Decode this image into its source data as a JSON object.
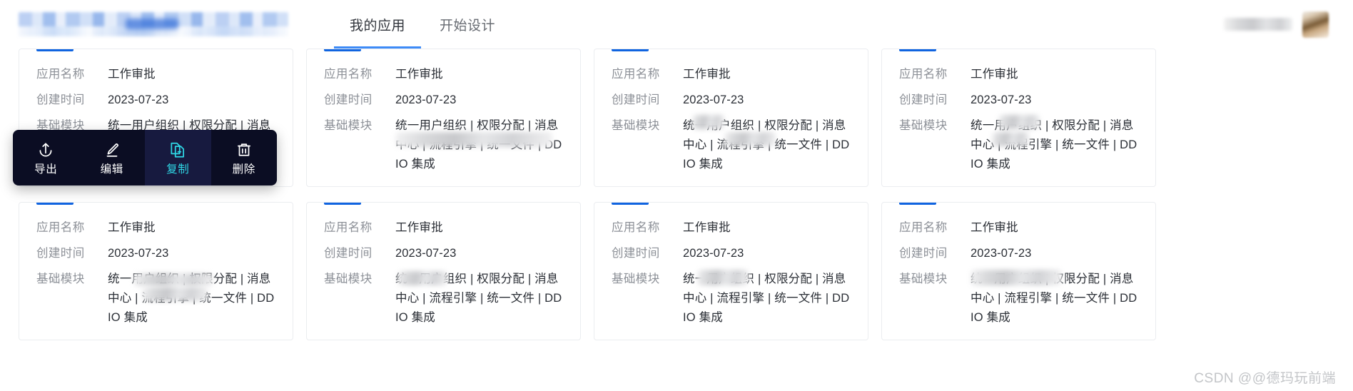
{
  "header": {
    "tabs": [
      {
        "label": "我的应用",
        "active": true
      },
      {
        "label": "开始设计",
        "active": false
      }
    ],
    "logo_alt": "blurred-product-logo",
    "user_alt": "blurred-user-name",
    "avatar_alt": "user-avatar"
  },
  "card_labels": {
    "name": "应用名称",
    "created": "创建时间",
    "modules": "基础模块"
  },
  "cards": [
    {
      "name": "工作审批",
      "created": "2023-07-23",
      "modules": "统一用户组织 | 权限分配 | 消息中心 | 流程引擎 | 统一文件 | DDIO 集成"
    },
    {
      "name": "工作审批",
      "created": "2023-07-23",
      "modules": "统一用户组织 | 权限分配 | 消息中心 | 流程引擎 | 统一文件 | DDIO 集成"
    },
    {
      "name": "工作审批",
      "created": "2023-07-23",
      "modules": "统一用户组织 | 权限分配 | 消息中心 | 流程引擎 | 统一文件 | DDIO 集成"
    },
    {
      "name": "工作审批",
      "created": "2023-07-23",
      "modules": "统一用户组织 | 权限分配 | 消息中心 | 流程引擎 | 统一文件 | DDIO 集成"
    },
    {
      "name": "工作审批",
      "created": "2023-07-23",
      "modules": "统一用户组织 | 权限分配 | 消息中心 | 流程引擎 | 统一文件 | DDIO 集成"
    },
    {
      "name": "工作审批",
      "created": "2023-07-23",
      "modules": "统一用户组织 | 权限分配 | 消息中心 | 流程引擎 | 统一文件 | DDIO 集成"
    },
    {
      "name": "工作审批",
      "created": "2023-07-23",
      "modules": "统一用户组织 | 权限分配 | 消息中心 | 流程引擎 | 统一文件 | DDIO 集成"
    },
    {
      "name": "工作审批",
      "created": "2023-07-23",
      "modules": "统一用户组织 | 权限分配 | 消息中心 | 流程引擎 | 统一文件 | DDIO 集成"
    }
  ],
  "context_menu": {
    "items": [
      {
        "label": "导出",
        "icon": "export-icon",
        "active": false
      },
      {
        "label": "编辑",
        "icon": "pencil-icon",
        "active": false
      },
      {
        "label": "复制",
        "icon": "copy-icon",
        "active": true
      },
      {
        "label": "删除",
        "icon": "trash-icon",
        "active": false
      }
    ]
  },
  "watermark": {
    "text": "CSDN @@德玛玩前端"
  },
  "colors": {
    "accent_blue": "#1064e0",
    "tab_underline": "#3d8bf7",
    "menu_bg": "#0b0d23",
    "menu_active_bg": "#171a3f",
    "menu_active_fg": "#2fd8e6",
    "label_gray": "#8c9097",
    "value_dark": "#2b2f36"
  }
}
